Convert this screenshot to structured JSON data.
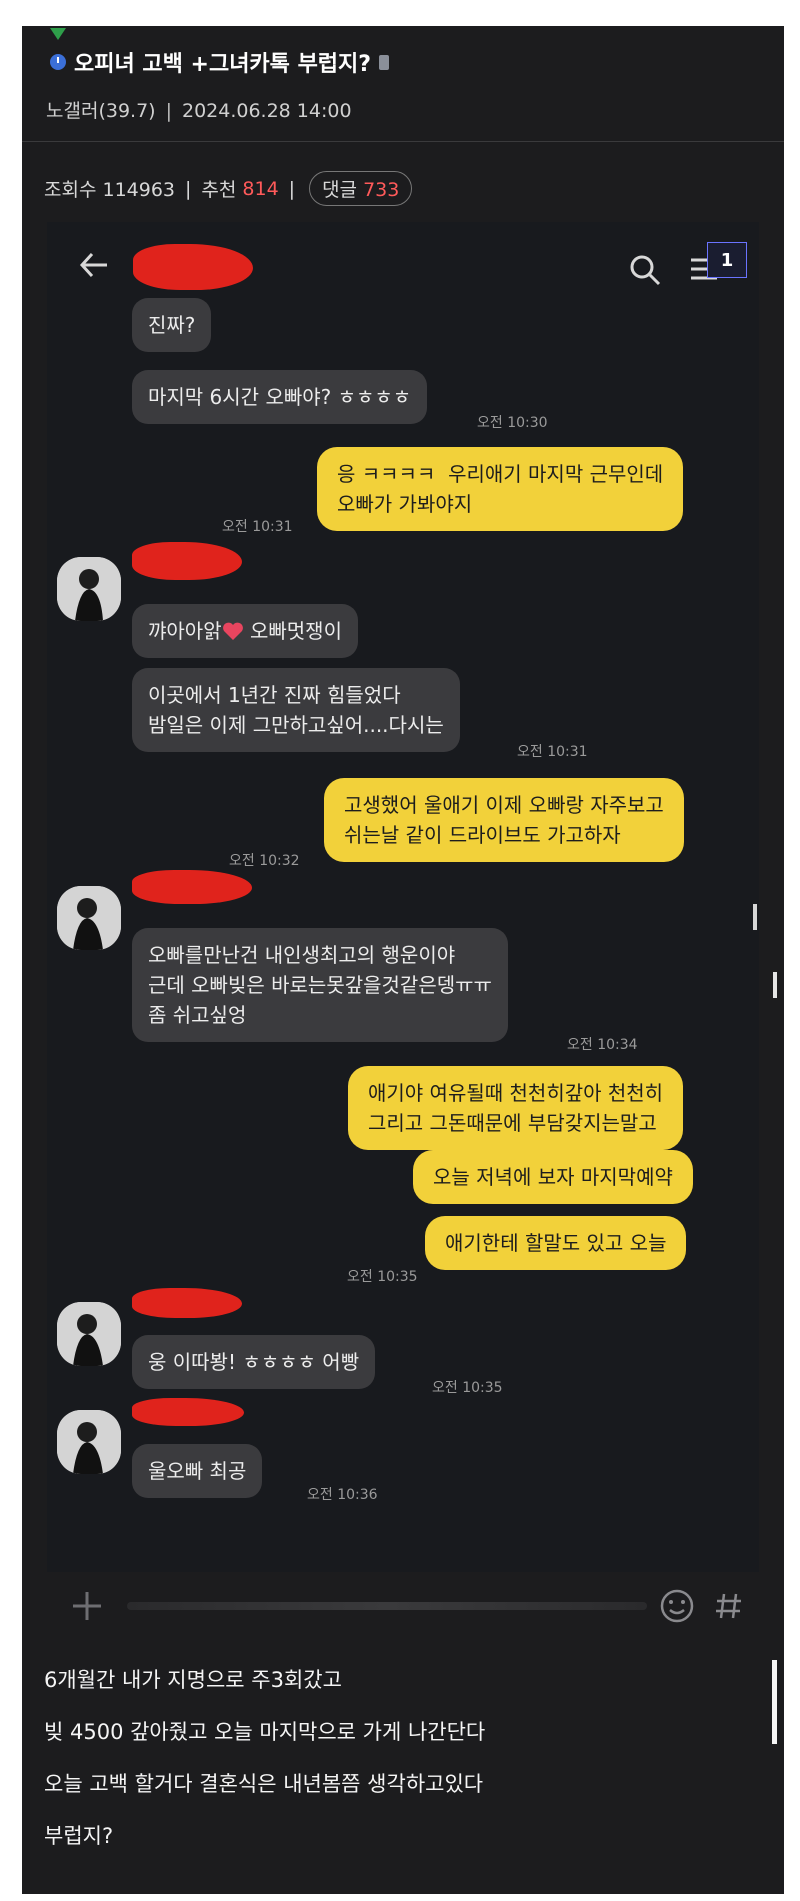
{
  "post": {
    "title": "오피녀 고백 +그녀카톡 부럽지?",
    "author": "노갤러(39.7)",
    "datetime": "2024.06.28 14:00",
    "views_label": "조회수 114963",
    "recommend_label": "추천",
    "recommend_count": "814",
    "comment_label": "댓글",
    "comment_count": "733"
  },
  "chat": {
    "page_badge": "1",
    "messages": [
      {
        "type": "in",
        "text": "진짜?"
      },
      {
        "type": "in",
        "text": "마지막 6시간 오빠야? ㅎㅎㅎㅎ",
        "time": "오전 10:30"
      },
      {
        "type": "out",
        "text": "응 ㅋㅋㅋㅋ  우리애기 마지막 근무인데\n오빠가 가봐야지",
        "time": "오전 10:31"
      },
      {
        "type": "in",
        "text": "꺄아아앍",
        "text_after": " 오빠멋쟁이"
      },
      {
        "type": "in",
        "text": "이곳에서 1년간 진짜 힘들었다\n밤일은 이제 그만하고싶어....다시는",
        "time": "오전 10:31"
      },
      {
        "type": "out",
        "text": "고생했어 울애기 이제 오빠랑 자주보고\n쉬는날 같이 드라이브도 가고하자",
        "time": "오전 10:32"
      },
      {
        "type": "in",
        "text": "오빠를만난건 내인생최고의 행운이야\n근데 오빠빚은 바로는못갚을것같은뎅ㅠㅠ\n좀 쉬고싶엉",
        "time": "오전 10:34"
      },
      {
        "type": "out",
        "text": "애기야 여유될때 천천히갚아 천천히\n그리고 그돈때문에 부담갖지는말고"
      },
      {
        "type": "out",
        "text": "오늘 저녁에 보자 마지막예약"
      },
      {
        "type": "out",
        "text": "애기한테 할말도 있고 오늘",
        "time": "오전 10:35"
      },
      {
        "type": "in",
        "text": "웅 이따봥! ㅎㅎㅎㅎ 어빵",
        "time": "오전 10:35"
      },
      {
        "type": "in",
        "text": "울오빠 최공",
        "time": "오전 10:36"
      }
    ]
  },
  "body": {
    "lines": [
      "6개월간 내가 지명으로 주3회갔고",
      "빚 4500 갚아줬고 오늘 마지막으로 가게 나간단다",
      "오늘 고백 할거다 결혼식은 내년봄쯤 생각하고있다",
      "부럽지?"
    ]
  },
  "icons": {
    "back": "back-arrow-icon",
    "search": "search-icon",
    "menu": "menu-icon",
    "plus": "plus-icon",
    "emoji": "emoji-icon",
    "hash": "hash-icon",
    "heart": "heart-icon"
  },
  "colors": {
    "out_bubble": "#f2d13a",
    "in_bubble": "#3b3b3e",
    "accent_red": "#ff5a5a",
    "redaction": "#e0231c"
  }
}
